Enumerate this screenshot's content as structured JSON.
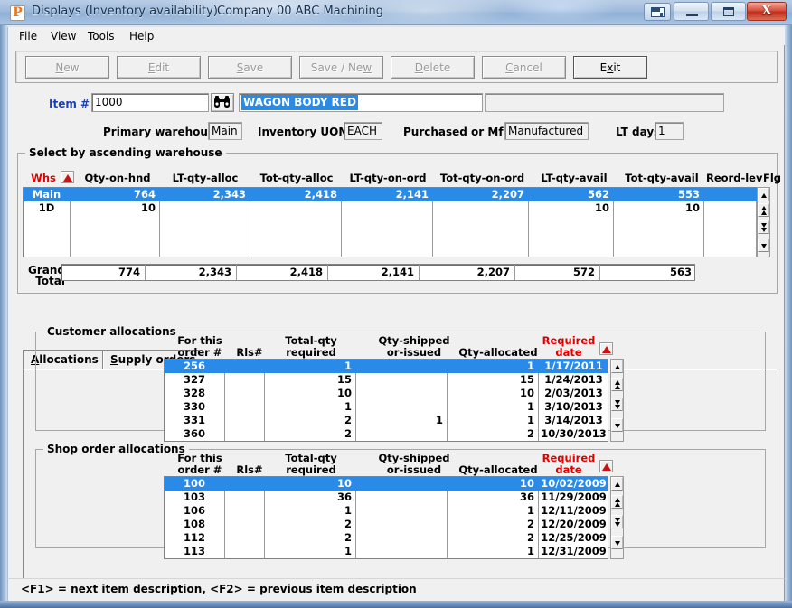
{
  "window": {
    "title": "Displays (Inventory availability)",
    "company": "Company 00  ABC Machining",
    "icon": "app-p-icon",
    "restore_group_tooltip": "Restore group",
    "minimize": "–",
    "maximize": "□",
    "close": "X"
  },
  "menu": {
    "items": [
      {
        "label": "File"
      },
      {
        "label": "View"
      },
      {
        "label": "Tools"
      },
      {
        "label": "Help"
      }
    ]
  },
  "toolbar": {
    "buttons": [
      {
        "label": "New",
        "accel": "N",
        "enabled": false
      },
      {
        "label": "Edit",
        "accel": "E",
        "enabled": false
      },
      {
        "label": "Save",
        "accel": "S",
        "enabled": false
      },
      {
        "label": "Save / New",
        "accel": "w",
        "enabled": false
      },
      {
        "label": "Delete",
        "accel": "D",
        "enabled": false
      },
      {
        "label": "Cancel",
        "accel": "C",
        "enabled": false
      },
      {
        "label": "Exit",
        "accel": "x",
        "enabled": true
      }
    ]
  },
  "item_header": {
    "item_label": "Item #",
    "item_value": "1000",
    "search_icon": "binoculars-icon",
    "description_value": "WAGON BODY RED",
    "description2_value": "",
    "primary_warehouse_label": "Primary warehouse:",
    "primary_warehouse_value": "Main",
    "inventory_uom_label": "Inventory UOM:",
    "inventory_uom_value": "EACH",
    "purchased_or_mfd_label": "Purchased or Mfd:",
    "purchased_or_mfd_value": "Manufactured",
    "lt_days_label": "LT days:",
    "lt_days_value": "1"
  },
  "warehouse_group": {
    "caption": "Select by ascending warehouse",
    "columns": [
      "Whs",
      "Qty-on-hnd",
      "LT-qty-alloc",
      "Tot-qty-alloc",
      "LT-qty-on-ord",
      "Tot-qty-on-ord",
      "LT-qty-avail",
      "Tot-qty-avail",
      "Reord-lev",
      "Flg"
    ],
    "sort_column": "Whs",
    "sort_direction": "ascending",
    "rows": [
      {
        "selected": true,
        "cells": [
          "Main",
          "764",
          "2,343",
          "2,418",
          "2,141",
          "2,207",
          "562",
          "553",
          "",
          ""
        ]
      },
      {
        "selected": false,
        "cells": [
          "1D",
          "10",
          "",
          "",
          "",
          "",
          "10",
          "10",
          "",
          ""
        ]
      }
    ],
    "grand_total_label_line1": "Grand",
    "grand_total_label_line2": "Total",
    "grand_total_cells": [
      "774",
      "2,343",
      "2,418",
      "2,141",
      "2,207",
      "572",
      "563"
    ]
  },
  "tabs": [
    {
      "label": "Allocations",
      "accel": "A",
      "active": true
    },
    {
      "label": "Supply orders",
      "accel": "S",
      "active": false
    }
  ],
  "customer_allocations": {
    "caption": "Customer allocations",
    "columns": [
      {
        "line1": "For this",
        "line2": "order #",
        "red": false
      },
      {
        "line1": "",
        "line2": "Rls#",
        "red": false
      },
      {
        "line1": "Total-qty",
        "line2": "required",
        "red": false
      },
      {
        "line1": "Qty-shipped",
        "line2": "or-issued",
        "red": false
      },
      {
        "line1": "",
        "line2": "Qty-allocated",
        "red": false
      },
      {
        "line1": "Required",
        "line2": "date",
        "red": true
      }
    ],
    "sort_column": "Required date",
    "rows": [
      {
        "selected": true,
        "order": "256",
        "rls": "",
        "total_qty": "1",
        "qty_shipped": "",
        "qty_allocated": "1",
        "required_date": "1/17/2011"
      },
      {
        "selected": false,
        "order": "327",
        "rls": "",
        "total_qty": "15",
        "qty_shipped": "",
        "qty_allocated": "15",
        "required_date": "1/24/2013"
      },
      {
        "selected": false,
        "order": "328",
        "rls": "",
        "total_qty": "10",
        "qty_shipped": "",
        "qty_allocated": "10",
        "required_date": "2/03/2013"
      },
      {
        "selected": false,
        "order": "330",
        "rls": "",
        "total_qty": "1",
        "qty_shipped": "",
        "qty_allocated": "1",
        "required_date": "3/10/2013"
      },
      {
        "selected": false,
        "order": "331",
        "rls": "",
        "total_qty": "2",
        "qty_shipped": "1",
        "qty_allocated": "1",
        "required_date": "3/14/2013"
      },
      {
        "selected": false,
        "order": "360",
        "rls": "",
        "total_qty": "2",
        "qty_shipped": "",
        "qty_allocated": "2",
        "required_date": "10/30/2013"
      }
    ]
  },
  "shop_order_allocations": {
    "caption": "Shop order allocations",
    "columns": [
      {
        "line1": "For this",
        "line2": "order #",
        "red": false
      },
      {
        "line1": "",
        "line2": "Rls#",
        "red": false
      },
      {
        "line1": "Total-qty",
        "line2": "required",
        "red": false
      },
      {
        "line1": "Qty-shipped",
        "line2": "or-issued",
        "red": false
      },
      {
        "line1": "",
        "line2": "Qty-allocated",
        "red": false
      },
      {
        "line1": "Required",
        "line2": "date",
        "red": true
      }
    ],
    "sort_column": "Required date",
    "rows": [
      {
        "selected": true,
        "order": "100",
        "rls": "",
        "total_qty": "10",
        "qty_shipped": "",
        "qty_allocated": "10",
        "required_date": "10/02/2009"
      },
      {
        "selected": false,
        "order": "103",
        "rls": "",
        "total_qty": "36",
        "qty_shipped": "",
        "qty_allocated": "36",
        "required_date": "11/29/2009"
      },
      {
        "selected": false,
        "order": "106",
        "rls": "",
        "total_qty": "1",
        "qty_shipped": "",
        "qty_allocated": "1",
        "required_date": "12/11/2009"
      },
      {
        "selected": false,
        "order": "108",
        "rls": "",
        "total_qty": "2",
        "qty_shipped": "",
        "qty_allocated": "2",
        "required_date": "12/20/2009"
      },
      {
        "selected": false,
        "order": "112",
        "rls": "",
        "total_qty": "2",
        "qty_shipped": "",
        "qty_allocated": "2",
        "required_date": "12/25/2009"
      },
      {
        "selected": false,
        "order": "113",
        "rls": "",
        "total_qty": "1",
        "qty_shipped": "",
        "qty_allocated": "1",
        "required_date": "12/31/2009"
      }
    ]
  },
  "statusbar": {
    "text": "<F1> = next item description, <F2> = previous item description"
  },
  "colors": {
    "selection": "#2a8ae8",
    "header_red": "#e00000",
    "label_blue": "#1a3fb8",
    "face": "#f0f0f0",
    "close_button": "#bf2d1c"
  }
}
